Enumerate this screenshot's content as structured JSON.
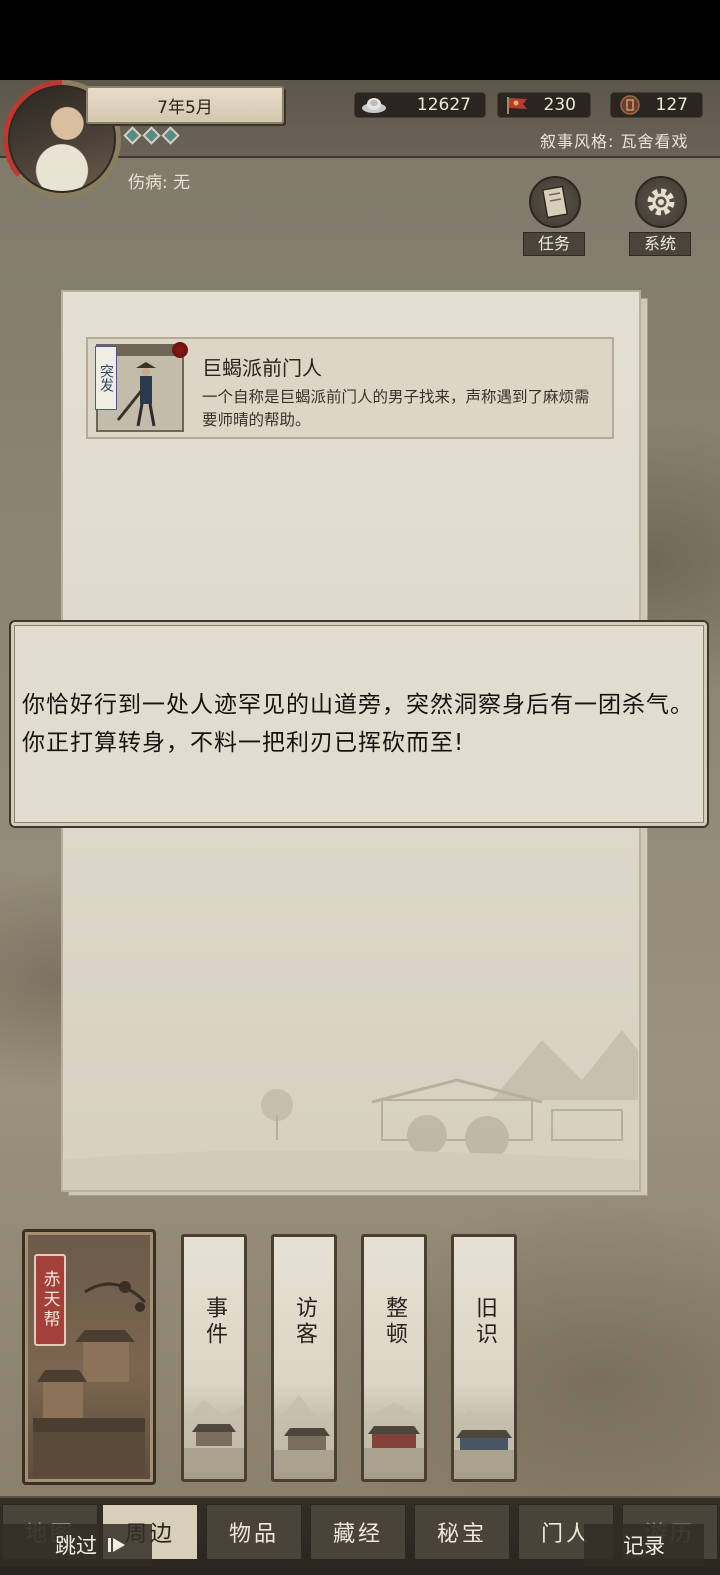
{
  "header": {
    "date": "7年5月",
    "injury": "伤病: 无",
    "narrative_style": "叙事风格: 瓦舍看戏"
  },
  "resources": {
    "silver": "12627",
    "flag": "230",
    "coin": "127"
  },
  "buttons": {
    "quest": "任务",
    "system": "系统"
  },
  "event": {
    "tag": "突发",
    "title": "巨蝎派前门人",
    "description": "一个自称是巨蝎派前门人的男子找来，声称遇到了麻烦需要师晴的帮助。"
  },
  "dialog": {
    "text": "你恰好行到一处人迹罕见的山道旁，突然洞察身后有一团杀气。你正打算转身，不料一把利刃已挥砍而至!"
  },
  "sect": {
    "name": "赤天帮"
  },
  "scrolls": [
    {
      "label": "事件"
    },
    {
      "label": "访客"
    },
    {
      "label": "整顿"
    },
    {
      "label": "旧识"
    }
  ],
  "nav": {
    "tabs": [
      "地图",
      "周边",
      "物品",
      "藏经",
      "秘宝",
      "门人",
      "游历"
    ],
    "active": "周边",
    "skip": "跳过",
    "record": "记录"
  },
  "colors": {
    "accent_red": "#b83a32",
    "diamond_teal": "#5a8a84",
    "panel_paper": "#e2dccf"
  }
}
